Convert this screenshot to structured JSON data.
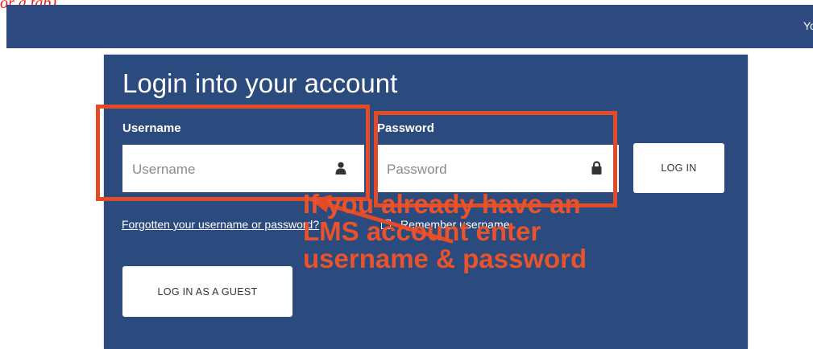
{
  "top_fragment": "or a tab)",
  "navbar": {
    "user_text": "You are not logged in"
  },
  "login": {
    "title": "Login into your account",
    "username_label": "Username",
    "username_placeholder": "Username",
    "password_label": "Password",
    "password_placeholder": "Password",
    "login_button": "LOG IN",
    "forgot_link": "Forgotten your username or password?",
    "remember_label": "Remember username",
    "guest_button": "LOG IN AS A GUEST"
  },
  "annotation": {
    "lines": [
      "If you already have an",
      "LMS account enter",
      "username & password"
    ],
    "color": "#e34a26"
  },
  "colors": {
    "navbar": "#2e4a80",
    "panel": "#2b4a7d"
  },
  "icons": {
    "username": "user-icon",
    "password": "lock-icon"
  }
}
